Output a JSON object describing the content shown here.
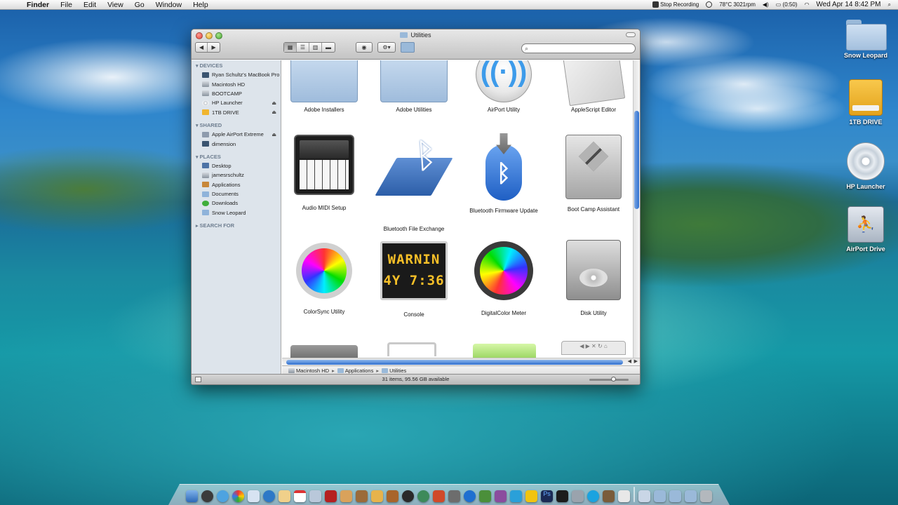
{
  "menubar": {
    "app": "Finder",
    "menus": [
      "File",
      "Edit",
      "View",
      "Go",
      "Window",
      "Help"
    ],
    "status": {
      "recording": "Stop Recording",
      "temp": "78°C 3021rpm",
      "battery": "(0:50)",
      "clock": "Wed Apr 14  8:42 PM"
    }
  },
  "desktop": {
    "icons": [
      {
        "label": "Snow Leopard",
        "icon": "folder-icon"
      },
      {
        "label": "1TB DRIVE",
        "icon": "usb-drive-icon"
      },
      {
        "label": "HP Launcher",
        "icon": "cd-icon"
      },
      {
        "label": "AirPort Drive",
        "icon": "network-drive-icon"
      }
    ]
  },
  "window": {
    "title": "Utilities",
    "search_placeholder": "",
    "sidebar": {
      "devices_header": "DEVICES",
      "devices": [
        {
          "label": "Ryan Schultz's MacBook Pro",
          "icon": "macbook-icon",
          "eject": false
        },
        {
          "label": "Macintosh HD",
          "icon": "hard-disk-icon",
          "eject": false
        },
        {
          "label": "BOOTCAMP",
          "icon": "hard-disk-icon",
          "eject": false
        },
        {
          "label": "HP Launcher",
          "icon": "cd-icon",
          "eject": true
        },
        {
          "label": "1TB DRIVE",
          "icon": "usb-drive-icon",
          "eject": true
        }
      ],
      "shared_header": "SHARED",
      "shared": [
        {
          "label": "Apple AirPort Extreme",
          "icon": "network-icon",
          "eject": true
        },
        {
          "label": "dimension",
          "icon": "computer-icon",
          "eject": false
        }
      ],
      "places_header": "PLACES",
      "places": [
        {
          "label": "Desktop",
          "icon": "desktop-icon"
        },
        {
          "label": "jamesrschultz",
          "icon": "home-icon"
        },
        {
          "label": "Applications",
          "icon": "applications-icon"
        },
        {
          "label": "Documents",
          "icon": "folder-icon"
        },
        {
          "label": "Downloads",
          "icon": "downloads-icon"
        },
        {
          "label": "Snow Leopard",
          "icon": "folder-icon"
        }
      ],
      "search_header": "SEARCH FOR"
    },
    "items": [
      {
        "label": "Adobe Installers",
        "icon": "folder-icon"
      },
      {
        "label": "Adobe Utilities",
        "icon": "folder-icon"
      },
      {
        "label": "AirPort Utility",
        "icon": "airport-utility-icon"
      },
      {
        "label": "AppleScript Editor",
        "icon": "applescript-editor-icon"
      },
      {
        "label": "Audio MIDI Setup",
        "icon": "audio-midi-setup-icon"
      },
      {
        "label": "Bluetooth File Exchange",
        "icon": "bluetooth-file-exchange-icon"
      },
      {
        "label": "Bluetooth Firmware Update",
        "icon": "bluetooth-firmware-update-icon"
      },
      {
        "label": "Boot Camp Assistant",
        "icon": "boot-camp-assistant-icon"
      },
      {
        "label": "ColorSync Utility",
        "icon": "colorsync-utility-icon"
      },
      {
        "label": "Console",
        "icon": "console-icon"
      },
      {
        "label": "DigitalColor Meter",
        "icon": "digitalcolor-meter-icon"
      },
      {
        "label": "Disk Utility",
        "icon": "disk-utility-icon"
      }
    ],
    "console_text": [
      "WARNIN",
      "4Y 7:36"
    ],
    "path": [
      "Macintosh HD",
      "Applications",
      "Utilities"
    ],
    "status": "31 items, 95.56 GB available"
  }
}
